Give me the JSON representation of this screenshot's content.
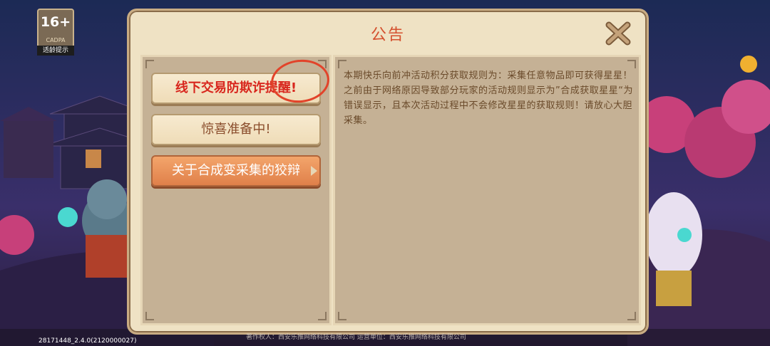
{
  "age_rating": {
    "label": "16+",
    "org": "CADPA",
    "hint": "适龄提示"
  },
  "dialog": {
    "title": "公告",
    "close_icon": "close-x-icon",
    "tabs": [
      {
        "label": "线下交易防欺诈提醒!",
        "state": "normal"
      },
      {
        "label": "惊喜准备中!",
        "state": "normal"
      },
      {
        "label": "关于合成变采集的狡辩",
        "state": "active"
      }
    ],
    "content": "本期快乐向前冲活动积分获取规则为：采集任意物品即可获得星星！之前由于网络原因导致部分玩家的活动规则显示为”合成获取星星“为错误显示，且本次活动过程中不会修改星星的获取规则！请放心大胆采集。"
  },
  "footer": {
    "version": "28171448_2.4.0(2120000027)",
    "copyright": "著作权人：西安乐推网络科技有限公司  运营单位：西安乐推网络科技有限公司"
  },
  "colors": {
    "title": "#d4502e",
    "accent_active": "#e0804a",
    "alert_text": "#d8261d",
    "annotation": "#e2432a"
  }
}
